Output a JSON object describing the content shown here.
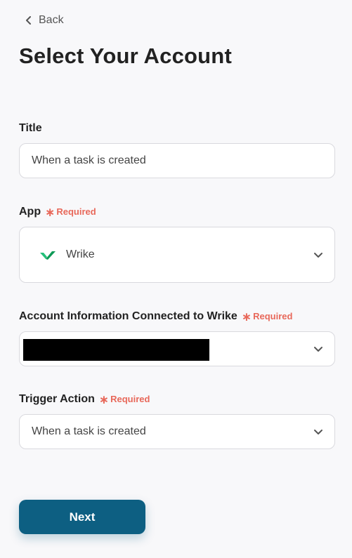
{
  "nav": {
    "back_label": "Back"
  },
  "page": {
    "title": "Select Your Account"
  },
  "required_label": "Required",
  "fields": {
    "title": {
      "label": "Title",
      "value": "When a task is created"
    },
    "app": {
      "label": "App",
      "value": "Wrike",
      "logo": "wrike-check-logo",
      "accent": "#1bb36a"
    },
    "account": {
      "label": "Account Information Connected to Wrike",
      "value_redacted": true
    },
    "trigger": {
      "label": "Trigger Action",
      "value": "When a task is created"
    }
  },
  "next_button": {
    "label": "Next",
    "color": "#0d5f82"
  },
  "colors": {
    "required": "#e8685a",
    "background": "#f8f8fa"
  }
}
